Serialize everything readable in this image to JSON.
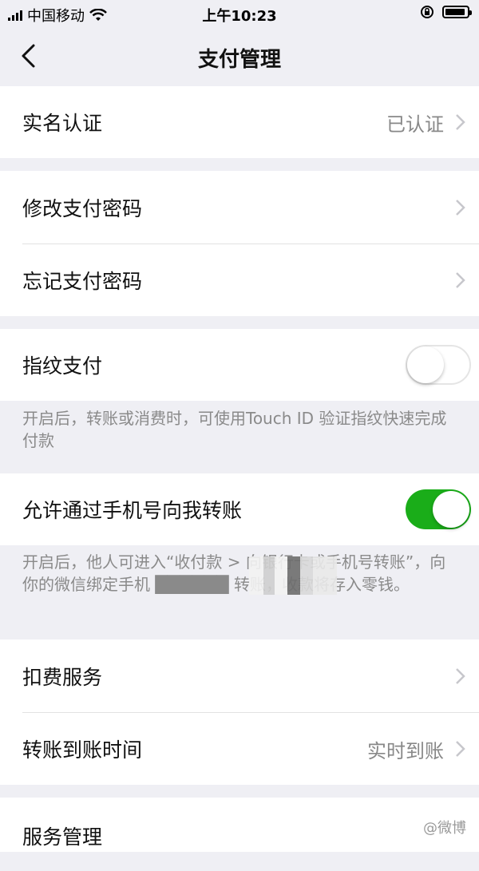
{
  "status_bar": {
    "carrier": "中国移动",
    "time": "上午10:23"
  },
  "nav": {
    "title": "支付管理"
  },
  "sections": {
    "identity": {
      "label": "实名认证",
      "value": "已认证"
    },
    "password": {
      "change_label": "修改支付密码",
      "forgot_label": "忘记支付密码"
    },
    "fingerprint": {
      "label": "指纹支付",
      "enabled": false,
      "note": "开启后，转账或消费时，可使用Touch ID 验证指纹快速完成付款"
    },
    "phone_transfer": {
      "label": "允许通过手机号向我转账",
      "enabled": true,
      "note": "开启后，他人可进入“收付款 > 向银行卡或手机号转账”，向你的微信绑定手机 ██████ 转账，收款将存入零钱。"
    },
    "services": {
      "deduction_label": "扣费服务",
      "arrival_label": "转账到账时间",
      "arrival_value": "实时到账"
    },
    "management": {
      "label": "服务管理"
    }
  },
  "watermark": {
    "text": "@微博"
  },
  "colors": {
    "accent_green": "#1aad19",
    "background": "#efeff4"
  }
}
